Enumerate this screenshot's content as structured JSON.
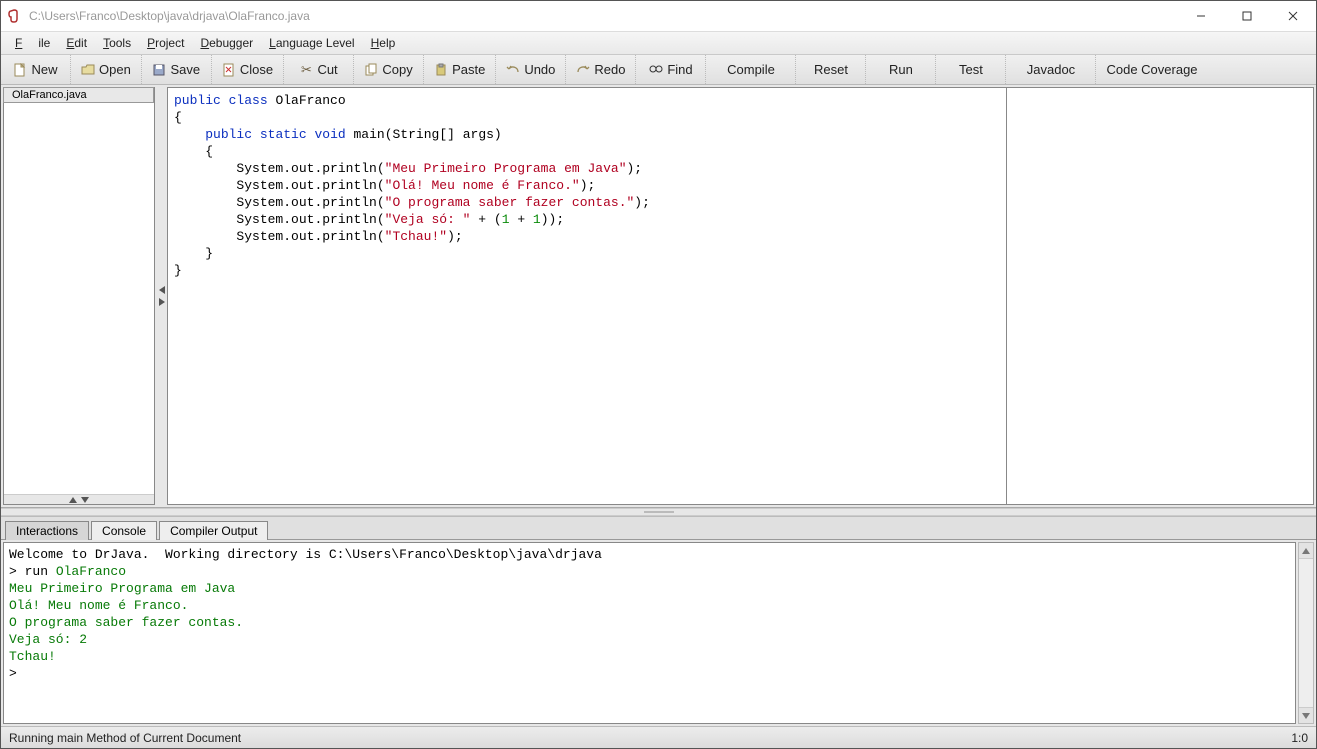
{
  "title": "C:\\Users\\Franco\\Desktop\\java\\drjava\\OlaFranco.java",
  "menus": {
    "file": "File",
    "edit": "Edit",
    "tools": "Tools",
    "project": "Project",
    "debugger": "Debugger",
    "language": "Language Level",
    "help": "Help"
  },
  "toolbar": {
    "new": "New",
    "open": "Open",
    "save": "Save",
    "close": "Close",
    "cut": "Cut",
    "copy": "Copy",
    "paste": "Paste",
    "undo": "Undo",
    "redo": "Redo",
    "find": "Find",
    "compile": "Compile",
    "reset": "Reset",
    "run": "Run",
    "test": "Test",
    "javadoc": "Javadoc",
    "coverage": "Code Coverage"
  },
  "openFile": "OlaFranco.java",
  "code": {
    "l1a": "public",
    "l1b": "class",
    "l1c": "OlaFranco",
    "l2": "{",
    "l3a": "public",
    "l3b": "static",
    "l3c": "void",
    "l3d": "main(String[] args)",
    "l4": "{",
    "l5a": "System",
    "l5b": ".out.println(",
    "l5s": "\"Meu Primeiro Programa em Java\"",
    "l5c": ");",
    "l6s": "\"Olá! Meu nome é Franco.\"",
    "l7s": "\"O programa saber fazer contas.\"",
    "l8s": "\"Veja só: \"",
    "l8plus": " + (",
    "l8n1": "1",
    "l8plus2": " + ",
    "l8n2": "1",
    "l8end": "));",
    "l9s": "\"Tchau!\"",
    "l10": "}",
    "l11": "}"
  },
  "bottomTabs": {
    "interactions": "Interactions",
    "console": "Console",
    "compiler": "Compiler Output"
  },
  "consoleLines": {
    "welcome": "Welcome to DrJava.  Working directory is C:\\Users\\Franco\\Desktop\\java\\drjava",
    "promptRun": "> run ",
    "runTarget": "OlaFranco",
    "o1": "Meu Primeiro Programa em Java",
    "o2": "Olá! Meu nome é Franco.",
    "o3": "O programa saber fazer contas.",
    "o4": "Veja só: 2",
    "o5": "Tchau!",
    "prompt2": "> "
  },
  "status": {
    "left": "Running main Method of Current Document",
    "right": "1:0"
  }
}
